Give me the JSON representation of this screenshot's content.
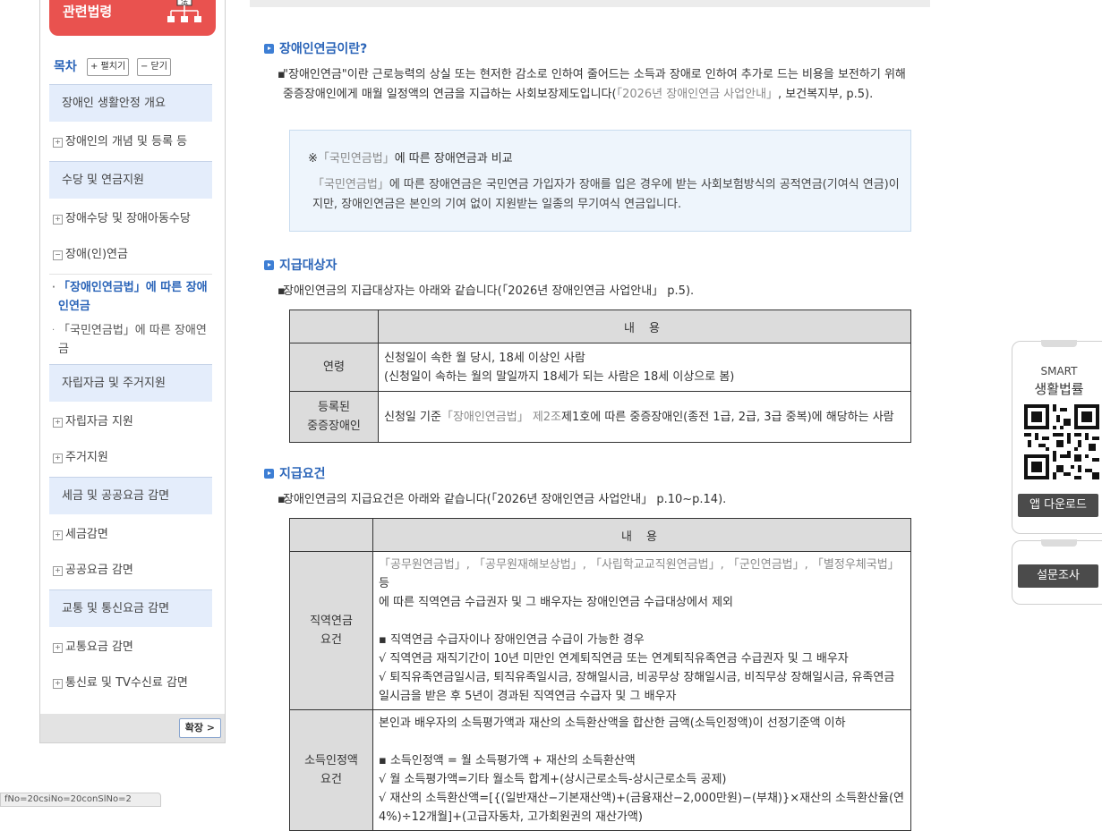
{
  "sidebar": {
    "law_button": "관련법령",
    "law_icon_char": "法",
    "toc": {
      "title": "목차",
      "expand_all": "+ 펼치기",
      "collapse_all": "− 닫기"
    },
    "sections": [
      "장애인 생활안정 개요",
      "수당 및 연금지원",
      "자립자금 및 주거지원",
      "세금 및 공공요금 감면",
      "교통 및 통신요금 감면"
    ],
    "items": [
      "장애인의 개념 및 등록 등",
      "장애수당 및 장애아동수당",
      "장애(인)연금",
      "자립자금 지원",
      "주거지원",
      "세금감면",
      "공공요금 감면",
      "교통요금 감면",
      "통신료 및 TV수신료 감면"
    ],
    "leaves": [
      "「장애인연금법」에 따른 장애인연금",
      "「국민연금법」에 따른 장애연금"
    ],
    "expand_button": "확장 >",
    "url_fragment": "fNo=20csiNo=20conSlNo=2"
  },
  "main": {
    "section1": {
      "title": "장애인연금이란?",
      "p1_a": "\"장애인연금\"이란 근로능력의 상실 또는 현저한 감소로 인하여 줄어드는 소득과 장애로 인하여 추가로 드는 비용을 보전하기 위해 중증장애인에게 매월 일정액의 연금을 지급하는 사회보장제도입니다(",
      "p1_ref": "「2026년 장애인연금 사업안내」",
      "p1_b": ", 보건복지부, p.5).",
      "note_prefix": "※",
      "note_ref": "「국민연금법」",
      "note_title_rest": "에 따른 장애연금과 비교",
      "note_text_ref": "「국민연금법」",
      "note_text_rest": "에 따른 장애연금은 국민연금 가입자가 장애를 입은 경우에 받는 사회보험방식의 공적연금(기여식 연금)이지만, 장애인연금은 본인의 기여 없이 지원받는 일종의 무기여식 연금입니다."
    },
    "section2": {
      "title": "지급대상자",
      "intro": "장애인연금의 지급대상자는 아래와 같습니다(「2026년 장애인연금 사업안내」 p.5).",
      "header": "내 용",
      "rows": [
        {
          "key": "연령",
          "line1": "신청일이 속한 월 당시, 18세 이상인 사람",
          "line2": "(신청일이 속하는 월의 말일까지 18세가 되는 사람은 18세 이상으로 봄)"
        },
        {
          "key1": "등록된",
          "key2": "중증장애인",
          "pre": "신청일 기준",
          "ref": "「장애인연금법」 제2조",
          "post": "제1호에 따른 중증장애인(종전 1급, 2급, 3급 중복)에 해당하는 사람"
        }
      ]
    },
    "section3": {
      "title": "지급요건",
      "intro": "장애인연금의 지급요건은 아래와 같습니다(「2026년 장애인연금 사업안내」 p.10~p.14).",
      "header": "내 용",
      "row1": {
        "key1": "직역연금",
        "key2": "요건",
        "refs": "「공무원연금법」, 「공무원재해보상법」, 「사립학교교직원연금법」, 「군인연금법」, 「별정우체국법」",
        "refs_tail": " 등",
        "line2": "에 따른 직역연금 수급권자 및 그 배우자는 장애인연금 수급대상에서 제외",
        "bullet": "▪ 직역연금 수급자이나 장애인연금 수급이 가능한 경우",
        "check1": "√ 직역연금 재직기간이 10년 미만인 연계퇴직연금 또는 연계퇴직유족연금 수급권자 및 그 배우자",
        "check2": "√ 퇴직유족연금일시금, 퇴직유족일시금, 장해일시금, 비공무상 장해일시금, 비직무상 장해일시금, 유족연금일시금을 받은 후 5년이 경과된 직역연금 수급자 및 그 배우자"
      },
      "row2": {
        "key1": "소득인정액",
        "key2": "요건",
        "line1": "본인과 배우자의 소득평가액과 재산의 소득환산액을 합산한 금액(소득인정액)이 선정기준액 이하",
        "bullet": "▪ 소득인정액 = 월 소득평가액 + 재산의 소득환산액",
        "check1": "√ 월 소득평가액=기타 월소득 합계+(상시근로소득-상시근로소득 공제)",
        "check2": "√ 재산의 소득환산액=[{(일반재산−기본재산액)+(금융재산−2,000만원)−(부채)}×재산의 소득환산율(연 4%)÷12개월]+(고급자동차, 고가회원권의 재산가액)"
      }
    }
  },
  "right_panel": {
    "smart_line1": "SMART",
    "smart_line2": "생활법률",
    "app_download": "앱 다운로드",
    "survey": "설문조사"
  }
}
